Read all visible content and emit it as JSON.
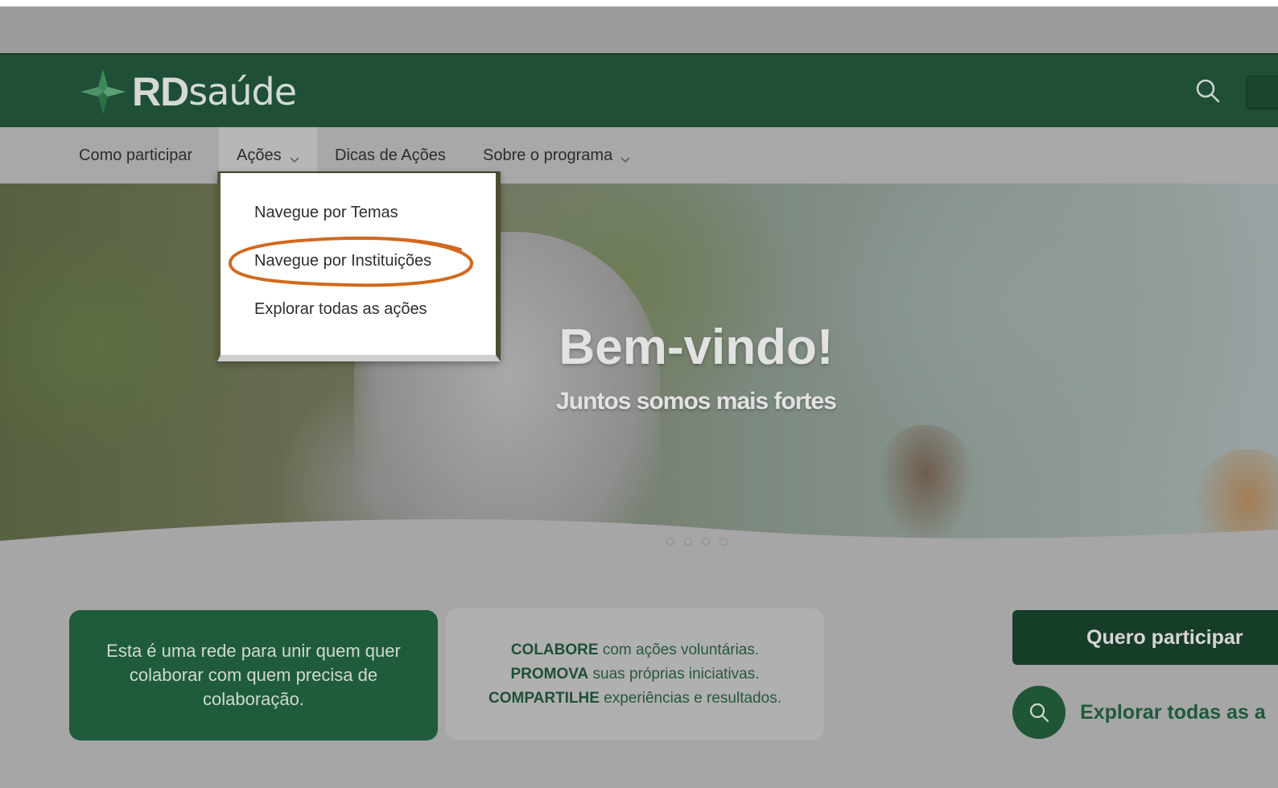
{
  "brand": {
    "logo_rd": "RD",
    "logo_saude": "saúde",
    "primary_color": "#1f4f36",
    "accent_annotation_color": "#d2691e"
  },
  "header": {
    "search_icon": "search-icon"
  },
  "nav": {
    "items": [
      {
        "label": "Como participar"
      },
      {
        "label": "Ações",
        "has_dropdown": true,
        "active": true
      },
      {
        "label": "Dicas de Ações"
      },
      {
        "label": "Sobre o programa",
        "has_dropdown": true
      }
    ]
  },
  "dropdown": {
    "items": [
      {
        "label": "Navegue por Temas"
      },
      {
        "label": "Navegue por Instituições",
        "highlighted": true
      },
      {
        "label": "Explorar todas as ações"
      }
    ]
  },
  "hero": {
    "title": "Bem-vindo!",
    "subtitle": "Juntos somos mais fortes",
    "carousel_dots": 4
  },
  "cards": {
    "green_text": "Esta é uma rede para unir quem quer colaborar com quem precisa de colaboração.",
    "gray_lines": [
      {
        "bold": "COLABORE",
        "rest": " com ações voluntárias."
      },
      {
        "bold": "PROMOVA",
        "rest": " suas próprias iniciativas."
      },
      {
        "bold": "COMPARTILHE",
        "rest": " experiências e resultados."
      }
    ]
  },
  "cta": {
    "participar_label": "Quero participar",
    "explore_label": "Explorar todas as a"
  }
}
